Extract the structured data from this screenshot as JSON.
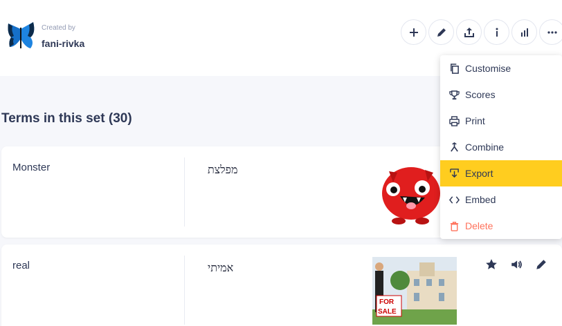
{
  "header": {
    "created_label": "Created by",
    "author": "fani-rivka"
  },
  "actions": [
    {
      "name": "add",
      "icon": "plus-icon"
    },
    {
      "name": "edit",
      "icon": "pencil-icon"
    },
    {
      "name": "share",
      "icon": "share-icon"
    },
    {
      "name": "info",
      "icon": "info-icon"
    },
    {
      "name": "stats",
      "icon": "bar-chart-icon"
    },
    {
      "name": "more",
      "icon": "more-icon"
    }
  ],
  "section": {
    "title": "Terms in this set",
    "count": "(30)"
  },
  "cards": [
    {
      "term": "Monster",
      "definition": "מפלצת"
    },
    {
      "term": "real",
      "definition": "אמיתי"
    }
  ],
  "menu": {
    "items": [
      {
        "label": "Customise",
        "icon": "copy-icon"
      },
      {
        "label": "Scores",
        "icon": "trophy-icon"
      },
      {
        "label": "Print",
        "icon": "printer-icon"
      },
      {
        "label": "Combine",
        "icon": "merge-icon"
      },
      {
        "label": "Export",
        "icon": "export-icon",
        "highlighted": true
      },
      {
        "label": "Embed",
        "icon": "code-icon"
      },
      {
        "label": "Delete",
        "icon": "trash-icon",
        "danger": true
      }
    ]
  },
  "colors": {
    "highlight": "#ffcd1f",
    "danger": "#ff725b",
    "text": "#2e3856",
    "background": "#f6f7fb"
  }
}
